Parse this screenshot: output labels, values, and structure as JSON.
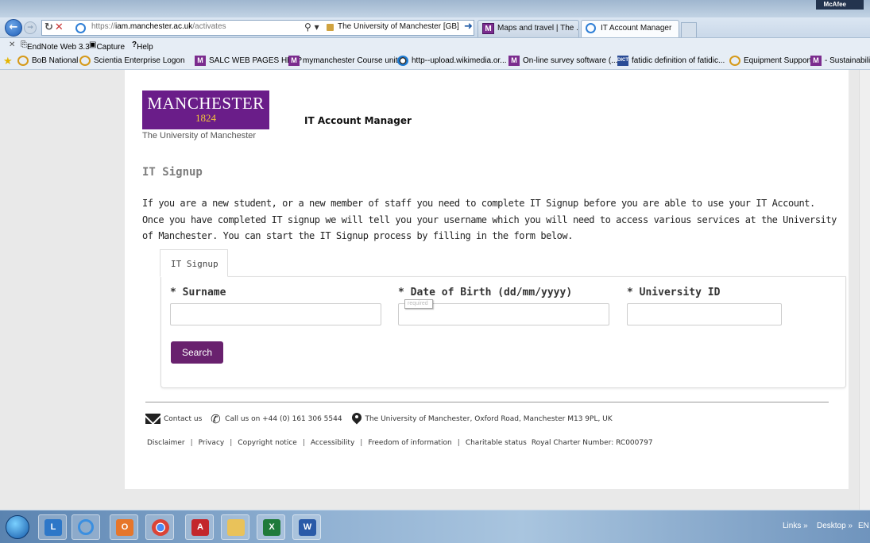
{
  "browser": {
    "mcafee_badge": "McAfee",
    "address": {
      "url_prefix": "https://",
      "url_host": "iam.manchester.ac.uk",
      "url_path": "/activates",
      "site_identity": "The University of Manchester [GB]"
    },
    "tabs": [
      {
        "label": "Maps and travel | The ...",
        "icon": "m-icon"
      },
      {
        "label": "IT Account Manager",
        "icon": "ie-icon",
        "active": true
      }
    ],
    "command_bar": {
      "endnote": "EndNote Web 3.3",
      "capture": "Capture",
      "help": "Help"
    },
    "favorites": [
      {
        "label": "BoB National",
        "icon": "ie"
      },
      {
        "label": "Scientia Enterprise Logon",
        "icon": "ie"
      },
      {
        "label": "SALC WEB PAGES HELP",
        "icon": "m"
      },
      {
        "label": "mymanchester Course unit...",
        "icon": "m"
      },
      {
        "label": "http--upload.wikimedia.or...",
        "icon": "w"
      },
      {
        "label": "On-line survey software (...",
        "icon": "m"
      },
      {
        "label": "fatidic definition of fatidic...",
        "icon": "dict"
      },
      {
        "label": "Equipment Support",
        "icon": "ie"
      },
      {
        "label": "- Sustainability",
        "icon": "m"
      }
    ]
  },
  "header": {
    "logo_line1": "MANCHESTER",
    "logo_line2": "1824",
    "logo_subtitle": "The University of Manchester",
    "app_title": "IT Account Manager"
  },
  "main": {
    "page_title": "IT Signup",
    "intro": "If you are a new student, or a new member of staff you need to complete IT Signup before you are able to use your IT Account. Once you have completed IT signup we will tell you your username which you will need to access various services at the University of Manchester. You can start the IT Signup process by filling in the form below.",
    "form": {
      "tab_label": "IT Signup",
      "surname_label": "* Surname",
      "surname_value": "",
      "dob_label": "* Date of Birth (dd/mm/yyyy)",
      "dob_value": "",
      "dob_tooltip": "required",
      "uni_id_label": "* University ID",
      "uni_id_value": "",
      "search_button": "Search"
    }
  },
  "footer": {
    "contact_us": "Contact us",
    "call_us": "Call us on +44 (0) 161 306 5544",
    "address": "The University of Manchester, Oxford Road, Manchester M13 9PL, UK",
    "links": [
      "Disclaimer",
      "Privacy",
      "Copyright notice",
      "Accessibility",
      "Freedom of information",
      "Charitable status"
    ],
    "charter": "Royal Charter Number: RC000797"
  },
  "taskbar": {
    "links": "Links",
    "desktop": "Desktop",
    "language": "EN"
  },
  "colors": {
    "brand_purple": "#6a1d89",
    "brand_gold": "#f3c63a",
    "button_purple": "#69216e"
  }
}
